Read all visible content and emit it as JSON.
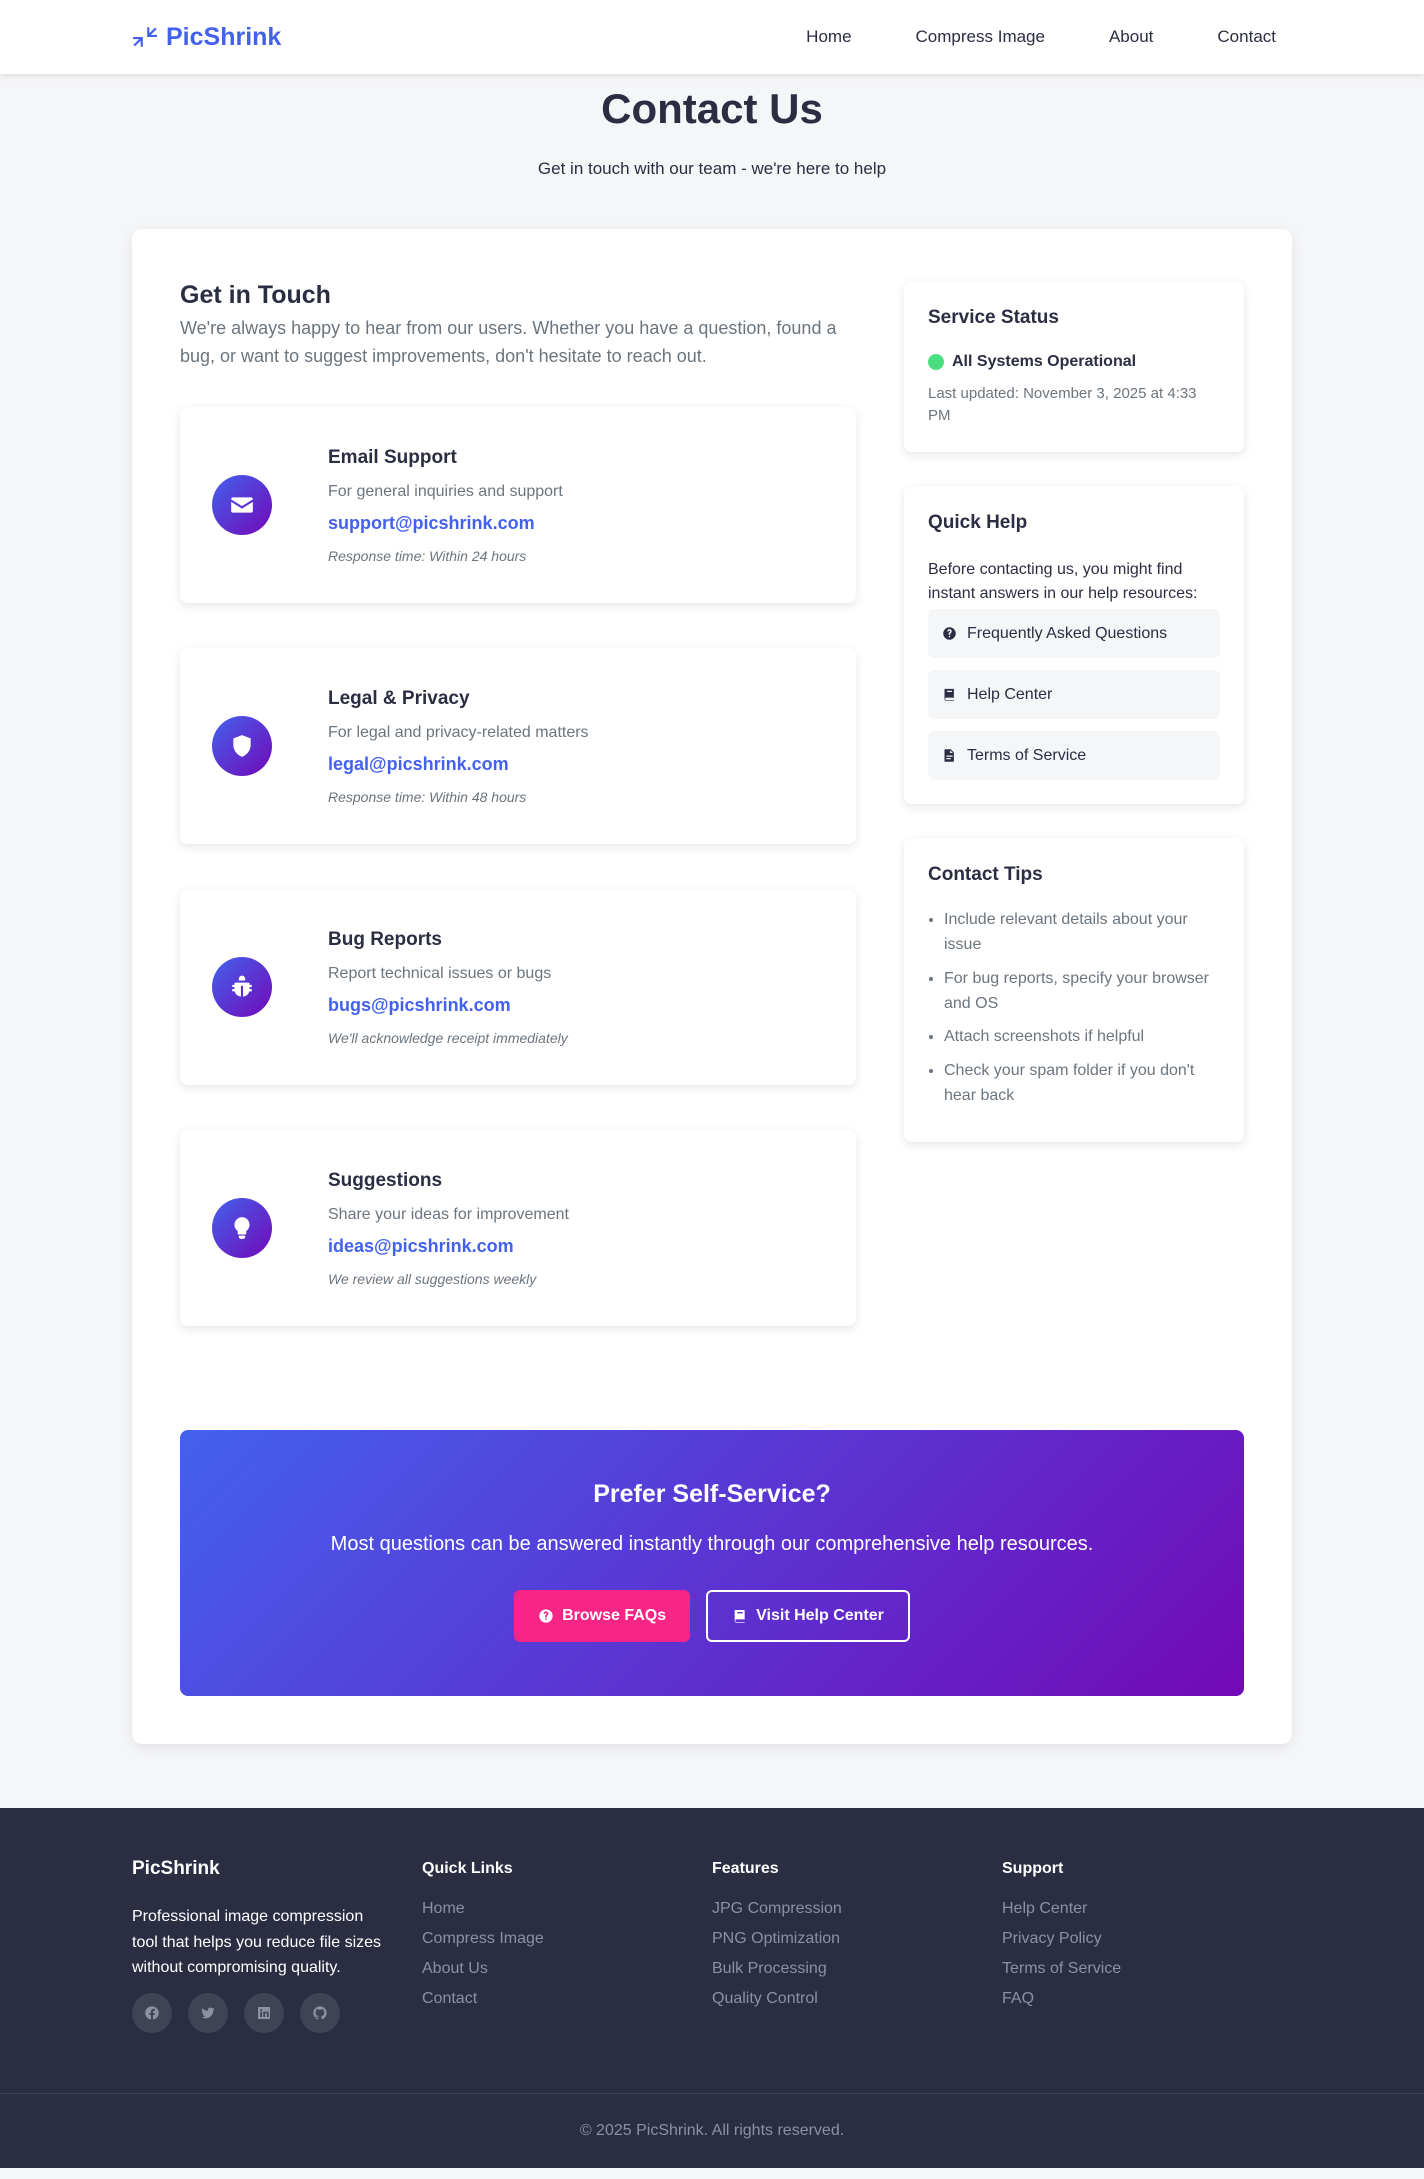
{
  "nav": {
    "brand": "PicShrink",
    "links": [
      "Home",
      "Compress Image",
      "About",
      "Contact"
    ]
  },
  "hero": {
    "title": "Contact Us",
    "subtitle": "Get in touch with our team - we're here to help"
  },
  "intro": {
    "title": "Get in Touch",
    "description": "We're always happy to hear from our users. Whether you have a question, found a bug, or want to suggest improvements, don't hesitate to reach out."
  },
  "contacts": [
    {
      "icon": "envelope-icon",
      "title": "Email Support",
      "subtitle": "For general inquiries and support",
      "email": "support@picshrink.com",
      "note": "Response time: Within 24 hours"
    },
    {
      "icon": "shield-icon",
      "title": "Legal & Privacy",
      "subtitle": "For legal and privacy-related matters",
      "email": "legal@picshrink.com",
      "note": "Response time: Within 48 hours"
    },
    {
      "icon": "bug-icon",
      "title": "Bug Reports",
      "subtitle": "Report technical issues or bugs",
      "email": "bugs@picshrink.com",
      "note": "We'll acknowledge receipt immediately"
    },
    {
      "icon": "lightbulb-icon",
      "title": "Suggestions",
      "subtitle": "Share your ideas for improvement",
      "email": "ideas@picshrink.com",
      "note": "We review all suggestions weekly"
    }
  ],
  "status": {
    "title": "Service Status",
    "text": "All Systems Operational",
    "updated": "Last updated: November 3, 2025 at 4:33 PM",
    "color": "#4ade80"
  },
  "quick_help": {
    "title": "Quick Help",
    "intro": "Before contacting us, you might find instant answers in our help resources:",
    "links": [
      {
        "icon": "question-circle-icon",
        "label": "Frequently Asked Questions"
      },
      {
        "icon": "book-icon",
        "label": "Help Center"
      },
      {
        "icon": "file-icon",
        "label": "Terms of Service"
      }
    ]
  },
  "tips": {
    "title": "Contact Tips",
    "items": [
      "Include relevant details about your issue",
      "For bug reports, specify your browser and OS",
      "Attach screenshots if helpful",
      "Check your spam folder if you don't hear back"
    ]
  },
  "cta": {
    "title": "Prefer Self-Service?",
    "text": "Most questions can be answered instantly through our comprehensive help resources.",
    "primary_label": "Browse FAQs",
    "secondary_label": "Visit Help Center"
  },
  "footer": {
    "brand": "PicShrink",
    "about": "Professional image compression tool that helps you reduce file sizes without compromising quality.",
    "socials": [
      "facebook-icon",
      "twitter-icon",
      "linkedin-icon",
      "github-icon"
    ],
    "columns": [
      {
        "heading": "Quick Links",
        "links": [
          "Home",
          "Compress Image",
          "About Us",
          "Contact"
        ]
      },
      {
        "heading": "Features",
        "links": [
          "JPG Compression",
          "PNG Optimization",
          "Bulk Processing",
          "Quality Control"
        ]
      },
      {
        "heading": "Support",
        "links": [
          "Help Center",
          "Privacy Policy",
          "Terms of Service",
          "FAQ"
        ]
      }
    ],
    "copyright": "© 2025 PicShrink. All rights reserved."
  },
  "colors": {
    "accent": "#4361ee",
    "accent2": "#7209b7",
    "pink": "#f72585",
    "dark": "#2b2d42"
  }
}
